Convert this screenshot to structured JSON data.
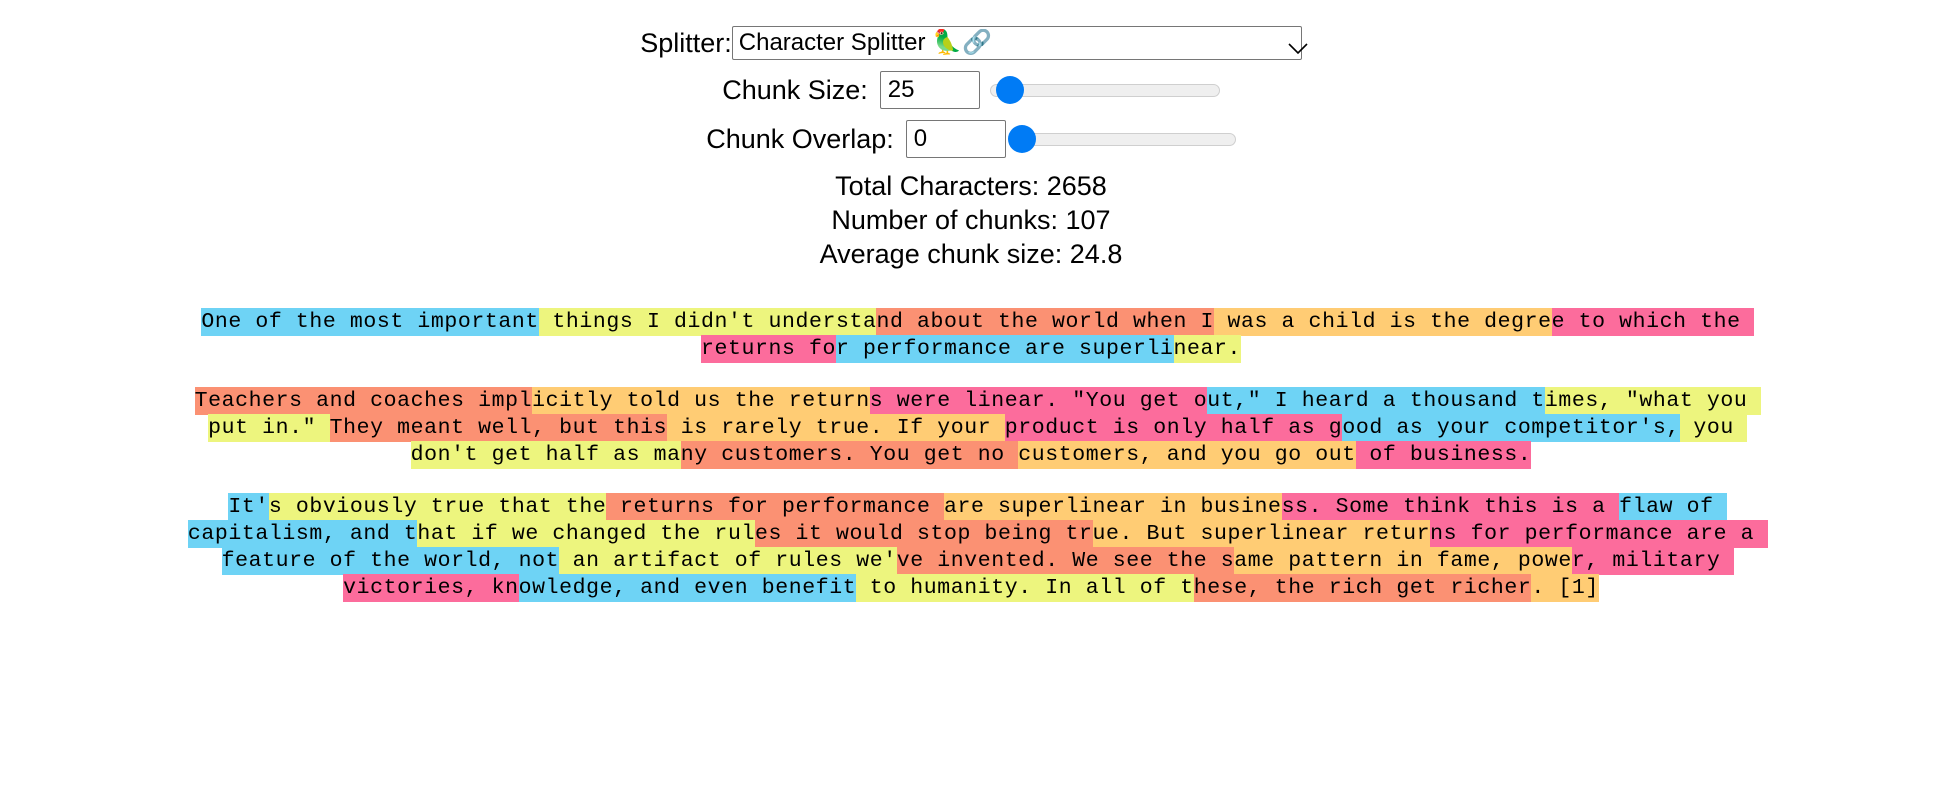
{
  "controls": {
    "splitter_label": "Splitter:",
    "splitter_value": "Character Splitter 🦜🔗",
    "splitter_options": [
      "Character Splitter 🦜🔗"
    ],
    "chunk_size_label": "Chunk Size:",
    "chunk_size_value": "25",
    "chunk_size_slider_percent": 9,
    "chunk_overlap_label": "Chunk Overlap:",
    "chunk_overlap_value": "0",
    "chunk_overlap_slider_percent": 3
  },
  "stats": {
    "total_characters": "Total Characters: 2658",
    "number_of_chunks": "Number of chunks: 107",
    "average_chunk_size": "Average chunk size: 24.8"
  },
  "palette": {
    "cyan": "#6ed3f5",
    "lime": "#edf57e",
    "salmon": "#fb9173",
    "orange": "#ffcc74",
    "pink": "#fc6c9c"
  },
  "chunk_colors": [
    "cyan",
    "lime",
    "salmon",
    "orange",
    "pink"
  ],
  "paragraphs": [
    {
      "id": "paragraph-1",
      "chunks": [
        "One of the most important",
        " things I didn't understa",
        "nd about the world when I",
        " was a child is the degre",
        "e to which the returns fo",
        "r performance are superli",
        "near."
      ]
    },
    {
      "id": "paragraph-2",
      "chunks": [
        "Teachers and coaches impl",
        "icitly told us the return",
        "s were linear. \"You get o",
        "ut,\" I heard a thousand t",
        "imes, \"what you put in.\" ",
        "They meant well, but this",
        " is rarely true. If your ",
        "product is only half as g",
        "ood as your competitor's,",
        " you don't get half as ma",
        "ny customers. You get no ",
        "customers, and you go out",
        " of business."
      ]
    },
    {
      "id": "paragraph-3",
      "chunks": [
        "It'",
        "s obviously true that the",
        " returns for performance ",
        "are superlinear in busine",
        "ss. Some think this is a ",
        "flaw of capitalism, and t",
        "hat if we changed the rul",
        "es it would stop being tr",
        "ue. But superlinear retur",
        "ns for performance are a ",
        "feature of the world, not",
        " an artifact of rules we'",
        "ve invented. We see the s",
        "ame pattern in fame, powe",
        "r, military victories, kn",
        "owledge, and even benefit",
        " to humanity. In all of t",
        "hese, the rich get richer",
        ". [1]"
      ]
    }
  ]
}
